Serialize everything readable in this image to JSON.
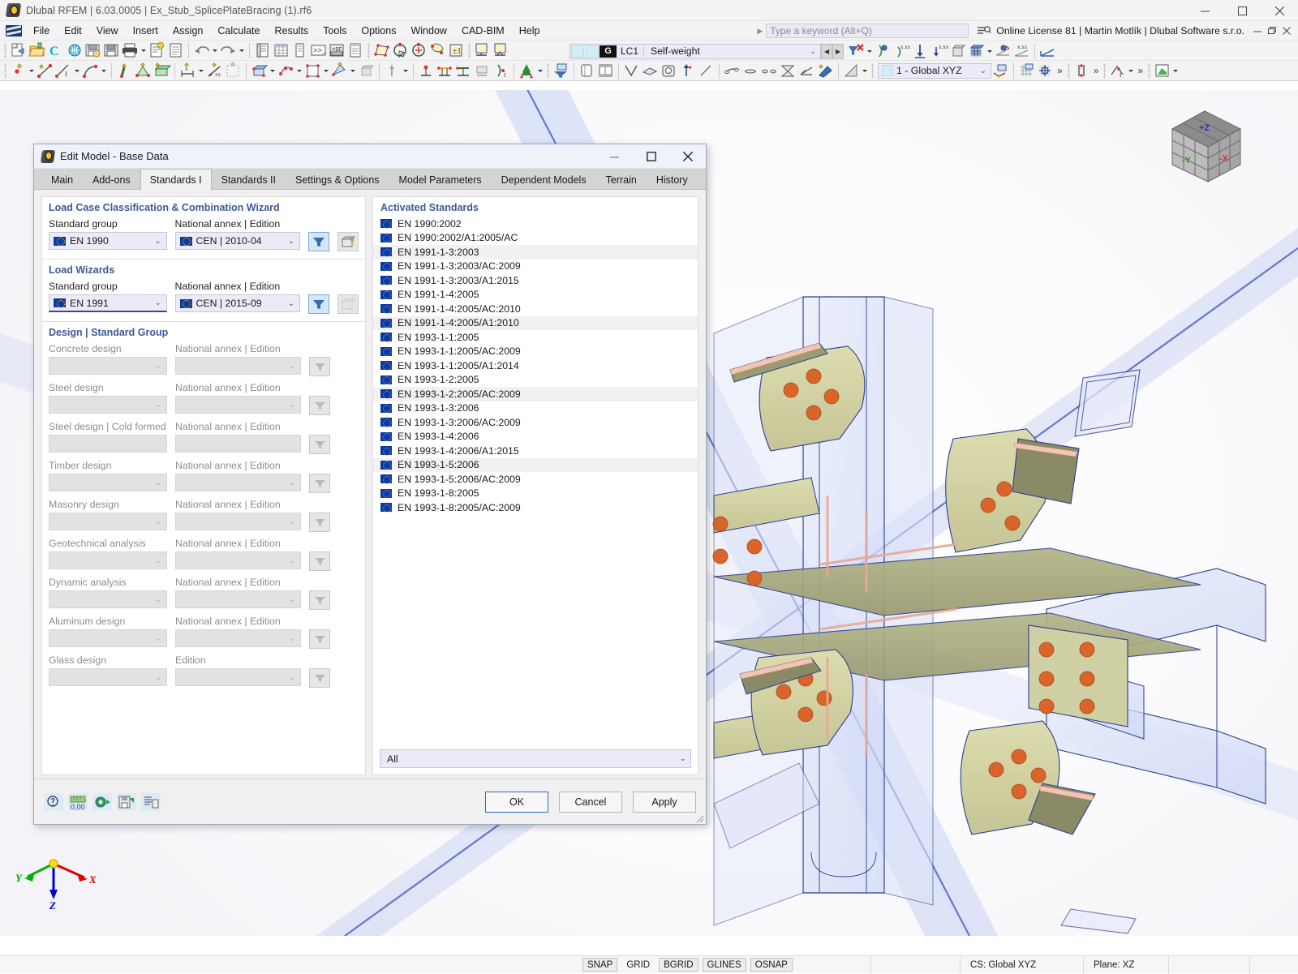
{
  "window": {
    "title": "Dlubal RFEM | 6.03.0005 | Ex_Stub_SplicePlateBracing (1).rf6",
    "app_icon": "rfem-logo-icon",
    "minimize": "minimize-icon",
    "maximize": "maximize-icon",
    "close": "close-icon"
  },
  "menubar": {
    "items": [
      "File",
      "Edit",
      "View",
      "Insert",
      "Assign",
      "Calculate",
      "Results",
      "Tools",
      "Options",
      "Window",
      "CAD-BIM",
      "Help"
    ],
    "search_placeholder": "Type a keyword (Alt+Q)",
    "license": "Online License 81 | Martin Motlík | Dlubal Software s.r.o."
  },
  "toolbar": {
    "load_case": {
      "group": "G",
      "id": "LC1",
      "name": "Self-weight"
    },
    "coordinate_system": "1 - Global XYZ",
    "overflow": "»"
  },
  "dialog": {
    "title": "Edit Model - Base Data",
    "icon": "rfem-logo-icon",
    "minimize": "minimize-icon",
    "maximize": "maximize-icon",
    "close": "close-icon",
    "tabs": [
      {
        "label": "Main",
        "active": false
      },
      {
        "label": "Add-ons",
        "active": false
      },
      {
        "label": "Standards I",
        "active": true
      },
      {
        "label": "Standards II",
        "active": false
      },
      {
        "label": "Settings & Options",
        "active": false
      },
      {
        "label": "Model Parameters",
        "active": false
      },
      {
        "label": "Dependent Models",
        "active": false
      },
      {
        "label": "Terrain",
        "active": false
      },
      {
        "label": "History",
        "active": false
      }
    ],
    "groups": [
      {
        "title": "Load Case Classification & Combination Wizard",
        "left_label": "Standard group",
        "left_value": "EN 1990",
        "right_label": "National annex | Edition",
        "right_value": "CEN | 2010-04",
        "filter_enabled": true,
        "extra_enabled": true
      },
      {
        "title": "Load Wizards",
        "left_label": "Standard group",
        "left_value": "EN 1991",
        "right_label": "National annex | Edition",
        "right_value": "CEN | 2015-09",
        "filter_enabled": true,
        "extra_enabled": false
      }
    ],
    "design_group": {
      "title": "Design | Standard Group",
      "rows": [
        {
          "label": "Concrete design",
          "value": "",
          "annex_label": "National annex | Edition",
          "annex_value": "",
          "has_caret": true
        },
        {
          "label": "Steel design",
          "value": "",
          "annex_label": "National annex | Edition",
          "annex_value": "",
          "has_caret": true
        },
        {
          "label": "Steel design | Cold formed",
          "value": "",
          "annex_label": "National annex | Edition",
          "annex_value": "",
          "has_caret": false
        },
        {
          "label": "Timber design",
          "value": "",
          "annex_label": "National annex | Edition",
          "annex_value": "",
          "has_caret": true
        },
        {
          "label": "Masonry design",
          "value": "",
          "annex_label": "National annex | Edition",
          "annex_value": "",
          "has_caret": true
        },
        {
          "label": "Geotechnical analysis",
          "value": "",
          "annex_label": "National annex | Edition",
          "annex_value": "",
          "has_caret": true
        },
        {
          "label": "Dynamic analysis",
          "value": "",
          "annex_label": "National annex | Edition",
          "annex_value": "",
          "has_caret": true
        },
        {
          "label": "Aluminum design",
          "value": "",
          "annex_label": "National annex | Edition",
          "annex_value": "",
          "has_caret": true
        },
        {
          "label": "Glass design",
          "value": "",
          "annex_label": "Edition",
          "annex_value": "",
          "has_caret": true
        }
      ]
    },
    "activated_standards": {
      "title": "Activated Standards",
      "items": [
        "EN 1990:2002",
        "EN 1990:2002/A1:2005/AC",
        "EN 1991-1-3:2003",
        "EN 1991-1-3:2003/AC:2009",
        "EN 1991-1-3:2003/A1:2015",
        "EN 1991-1-4:2005",
        "EN 1991-1-4:2005/AC:2010",
        "EN 1991-1-4:2005/A1:2010",
        "EN 1993-1-1:2005",
        "EN 1993-1-1:2005/AC:2009",
        "EN 1993-1-1:2005/A1:2014",
        "EN 1993-1-2:2005",
        "EN 1993-1-2:2005/AC:2009",
        "EN 1993-1-3:2006",
        "EN 1993-1-3:2006/AC:2009",
        "EN 1993-1-4:2006",
        "EN 1993-1-4:2006/A1:2015",
        "EN 1993-1-5:2006",
        "EN 1993-1-5:2006/AC:2009",
        "EN 1993-1-8:2005",
        "EN 1993-1-8:2005/AC:2009"
      ],
      "filter_value": "All"
    },
    "footer": {
      "icons": [
        "help-icon",
        "units-icon",
        "settings-icon",
        "save-defaults-icon",
        "info-icon"
      ],
      "ok": "OK",
      "cancel": "Cancel",
      "apply": "Apply"
    }
  },
  "viewport": {
    "axes": {
      "x": "X",
      "y": "Y",
      "z": "Z"
    },
    "navcube": {
      "top": "+Z",
      "left": "-Y",
      "right": "-X"
    }
  },
  "statusbar": {
    "toggles": [
      {
        "label": "SNAP",
        "on": true
      },
      {
        "label": "GRID",
        "on": false
      },
      {
        "label": "BGRID",
        "on": true
      },
      {
        "label": "GLINES",
        "on": true
      },
      {
        "label": "OSNAP",
        "on": true
      }
    ],
    "cs": "CS: Global XYZ",
    "plane": "Plane: XZ"
  }
}
